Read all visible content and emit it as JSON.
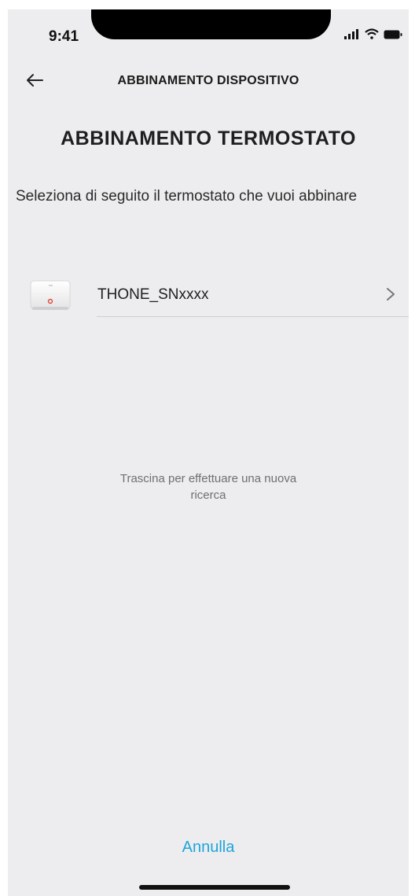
{
  "status_bar": {
    "time": "9:41"
  },
  "header": {
    "title": "ABBINAMENTO DISPOSITIVO",
    "back_icon": "arrow-left-icon"
  },
  "main": {
    "title": "ABBINAMENTO TERMOSTATO",
    "instruction": "Seleziona di seguito il termostato che vuoi abbinare",
    "devices": [
      {
        "name": "THONE_SNxxxx",
        "thumbnail": "thermostat-device-image"
      }
    ],
    "pull_hint": "Trascina per effettuare una nuova ricerca"
  },
  "footer": {
    "cancel_label": "Annulla"
  },
  "colors": {
    "background": "#ededef",
    "accent": "#1ea5da",
    "text": "#1e1e1e"
  }
}
